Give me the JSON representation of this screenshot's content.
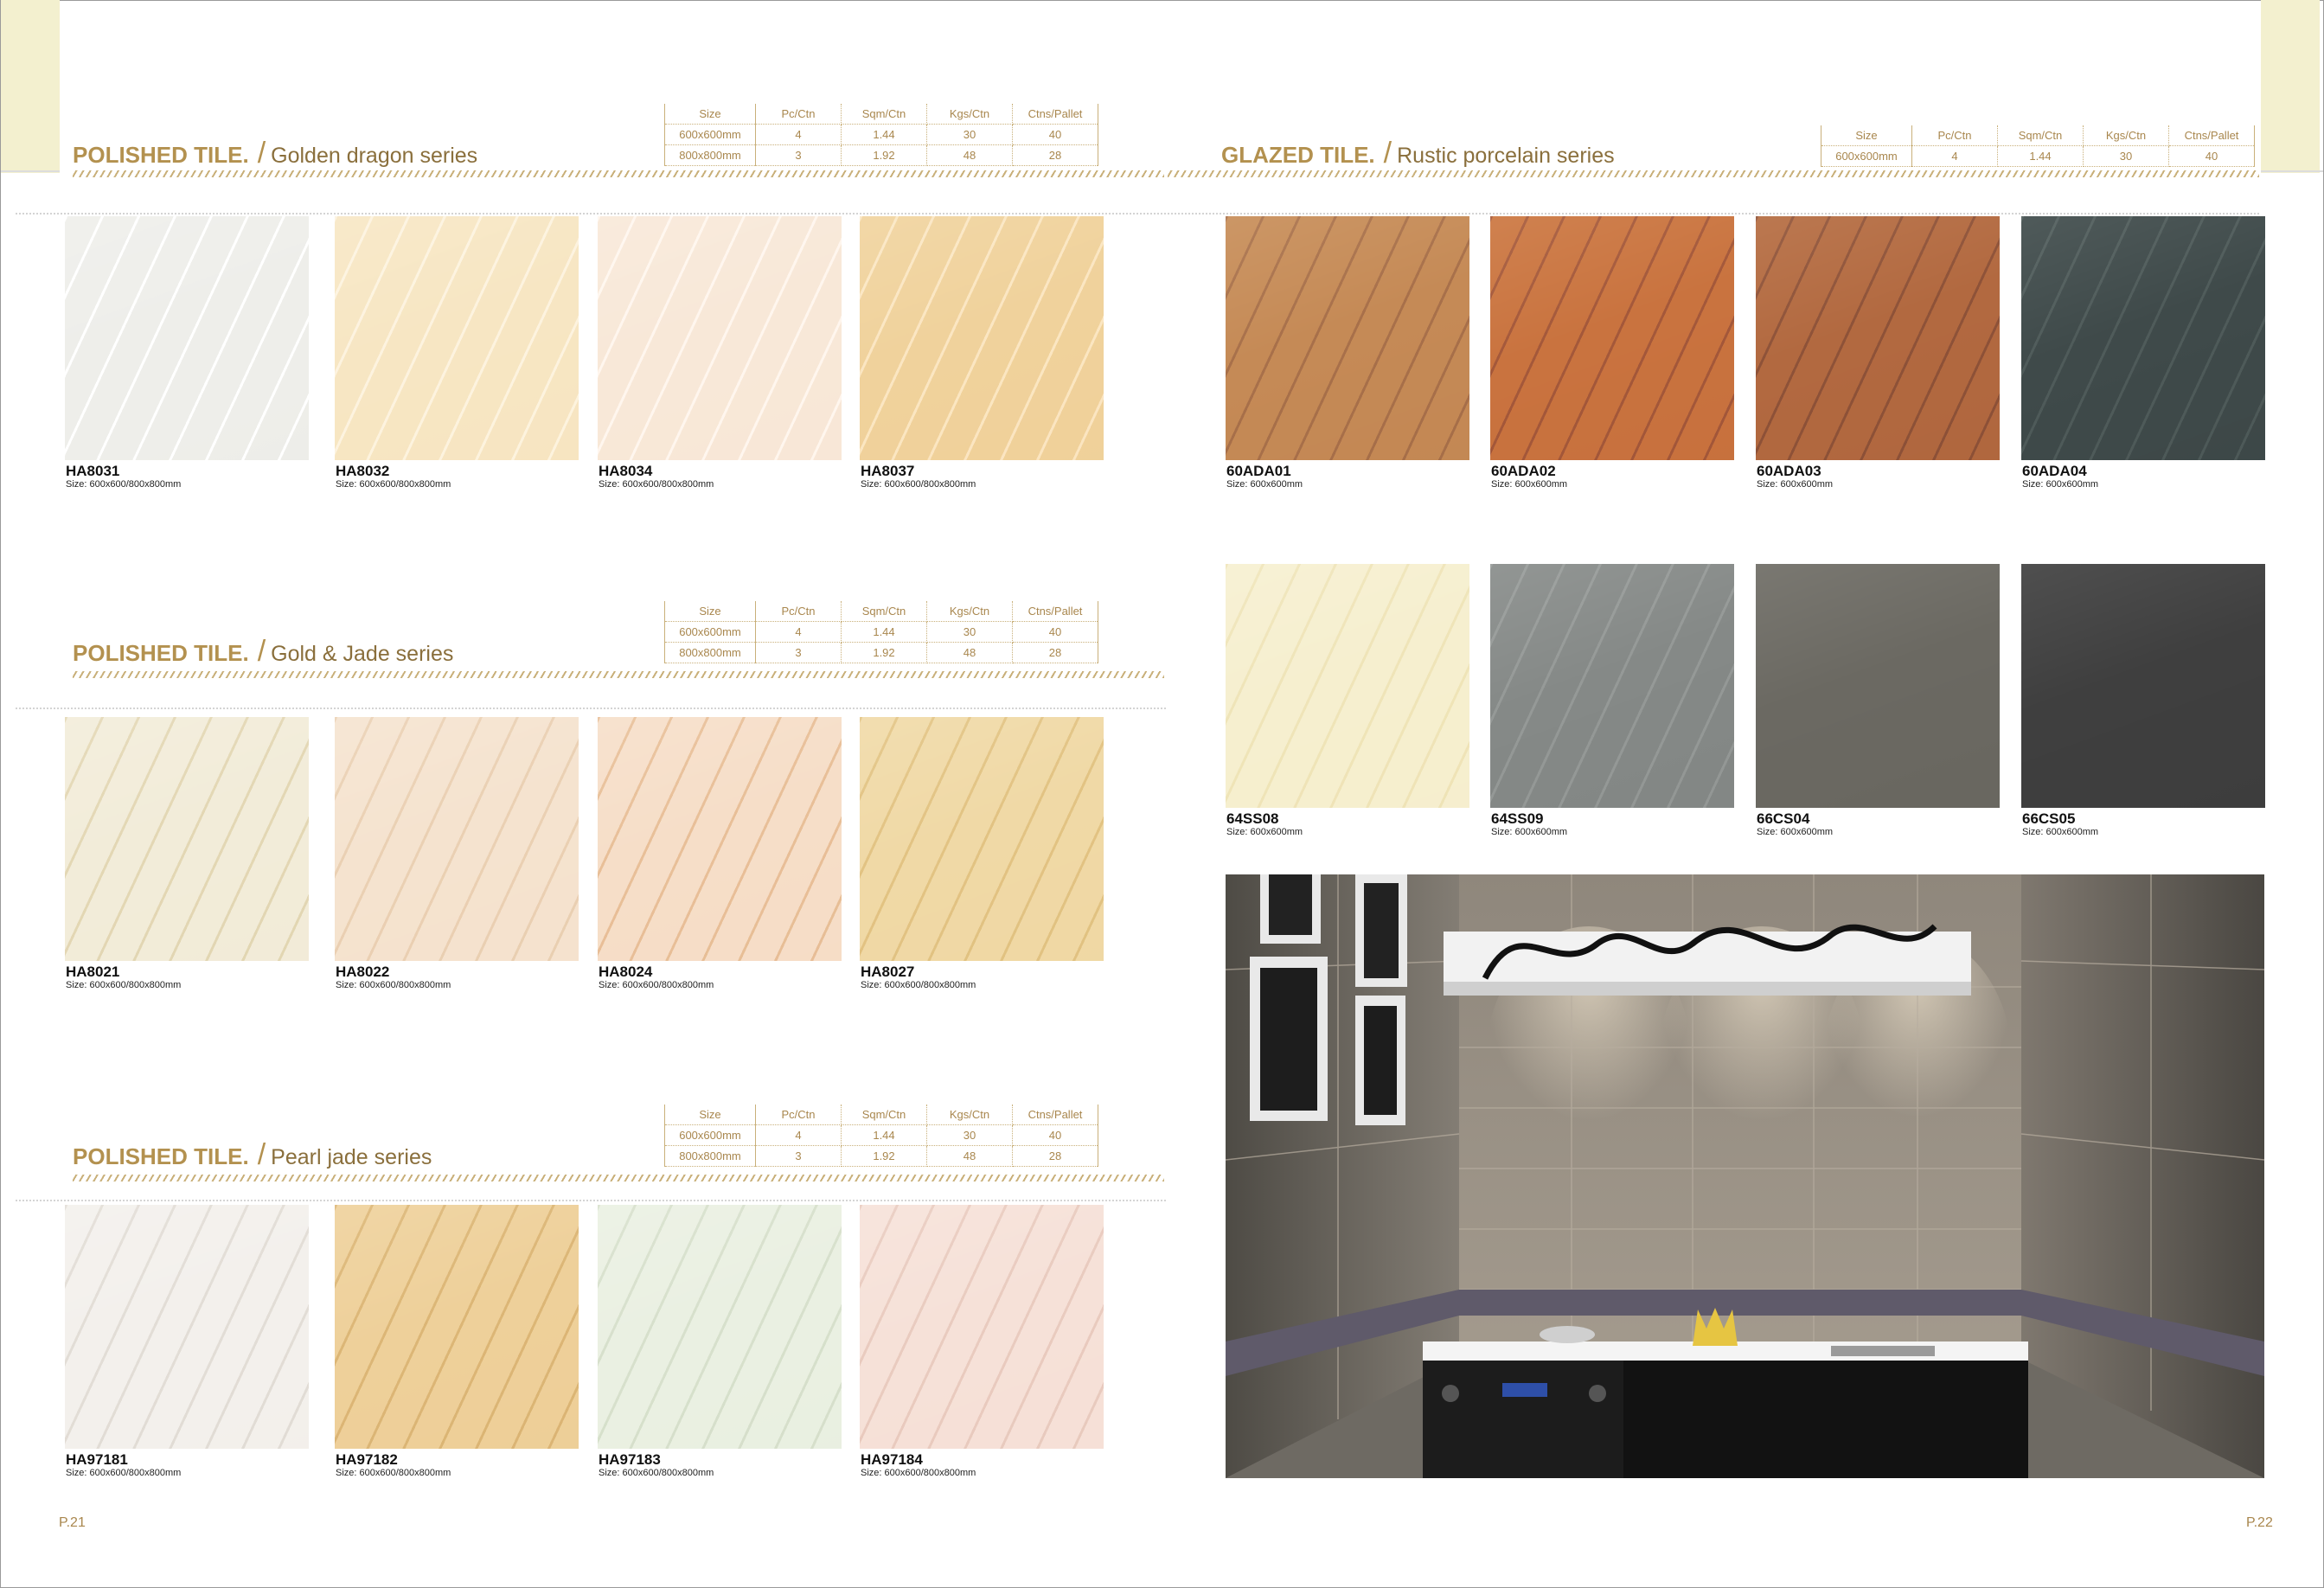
{
  "spec_headers": [
    "Size",
    "Pc/Ctn",
    "Sqm/Ctn",
    "Kgs/Ctn",
    "Ctns/Pallet"
  ],
  "left_sections": [
    {
      "heading_strong": "POLISHED TILE.",
      "heading_sub": "Golden dragon series",
      "rows": [
        [
          "600x600mm",
          "4",
          "1.44",
          "30",
          "40"
        ],
        [
          "800x800mm",
          "3",
          "1.92",
          "48",
          "28"
        ]
      ],
      "tiles": [
        {
          "code": "HA8031",
          "size": "Size: 600x600/800x800mm",
          "color": "#eeeeea",
          "vein": "#ffffff"
        },
        {
          "code": "HA8032",
          "size": "Size: 600x600/800x800mm",
          "color": "#f7e6c3",
          "vein": "#fdf3df"
        },
        {
          "code": "HA8034",
          "size": "Size: 600x600/800x800mm",
          "color": "#f8e8d8",
          "vein": "#fff6ee"
        },
        {
          "code": "HA8037",
          "size": "Size: 600x600/800x800mm",
          "color": "#f0d29c",
          "vein": "#fbe6c2"
        }
      ]
    },
    {
      "heading_strong": "POLISHED TILE.",
      "heading_sub": "Gold & Jade series",
      "rows": [
        [
          "600x600mm",
          "4",
          "1.44",
          "30",
          "40"
        ],
        [
          "800x800mm",
          "3",
          "1.92",
          "48",
          "28"
        ]
      ],
      "tiles": [
        {
          "code": "HA8021",
          "size": "Size: 600x600/800x800mm",
          "color": "#f2ecd9",
          "vein": "#e3d7b4"
        },
        {
          "code": "HA8022",
          "size": "Size: 600x600/800x800mm",
          "color": "#f5e3cf",
          "vein": "#ead0b3"
        },
        {
          "code": "HA8024",
          "size": "Size: 600x600/800x800mm",
          "color": "#f6dec8",
          "vein": "#e8bf98"
        },
        {
          "code": "HA8027",
          "size": "Size: 600x600/800x800mm",
          "color": "#f0d9a6",
          "vein": "#e2c383"
        }
      ]
    },
    {
      "heading_strong": "POLISHED TILE.",
      "heading_sub": "Pearl jade series",
      "rows": [
        [
          "600x600mm",
          "4",
          "1.44",
          "30",
          "40"
        ],
        [
          "800x800mm",
          "3",
          "1.92",
          "48",
          "28"
        ]
      ],
      "tiles": [
        {
          "code": "HA97181",
          "size": "Size: 600x600/800x800mm",
          "color": "#f3f0ec",
          "vein": "#e2ddd6"
        },
        {
          "code": "HA97182",
          "size": "Size: 600x600/800x800mm",
          "color": "#eed09a",
          "vein": "#dcb676"
        },
        {
          "code": "HA97183",
          "size": "Size: 600x600/800x800mm",
          "color": "#eaf0e2",
          "vein": "#d7e0cc"
        },
        {
          "code": "HA97184",
          "size": "Size: 600x600/800x800mm",
          "color": "#f6e1d8",
          "vein": "#e9cbbf"
        }
      ]
    }
  ],
  "right_section": {
    "heading_strong": "GLAZED TILE.",
    "heading_sub": "Rustic porcelain series",
    "rows": [
      [
        "600x600mm",
        "4",
        "1.44",
        "30",
        "40"
      ]
    ],
    "tiles": [
      {
        "code": "60ADA01",
        "size": "Size: 600x600mm",
        "color": "#c58a56",
        "vein": "#a8704a"
      },
      {
        "code": "60ADA02",
        "size": "Size: 600x600mm",
        "color": "#c9733f",
        "vein": "#a4583a"
      },
      {
        "code": "60ADA03",
        "size": "Size: 600x600mm",
        "color": "#b26940",
        "vein": "#8e5238"
      },
      {
        "code": "60ADA04",
        "size": "Size: 600x600mm",
        "color": "#3f4a4a",
        "vein": "#4f5b5a"
      },
      {
        "code": "64SS08",
        "size": "Size: 600x600mm",
        "color": "#f6efcf",
        "vein": "#efe4b8"
      },
      {
        "code": "64SS09",
        "size": "Size: 600x600mm",
        "color": "#858987",
        "vein": "#959997"
      },
      {
        "code": "66CS04",
        "size": "Size: 600x600mm",
        "color": "#6b6962",
        "vein": "#6b6962"
      },
      {
        "code": "66CS05",
        "size": "Size: 600x600mm",
        "color": "#3f3f3f",
        "vein": "#3f3f3f"
      }
    ]
  },
  "page_left": "P.21",
  "page_right": "P.22",
  "colors": {
    "gold": "#b3914f",
    "tab": "#f3f0cf"
  }
}
